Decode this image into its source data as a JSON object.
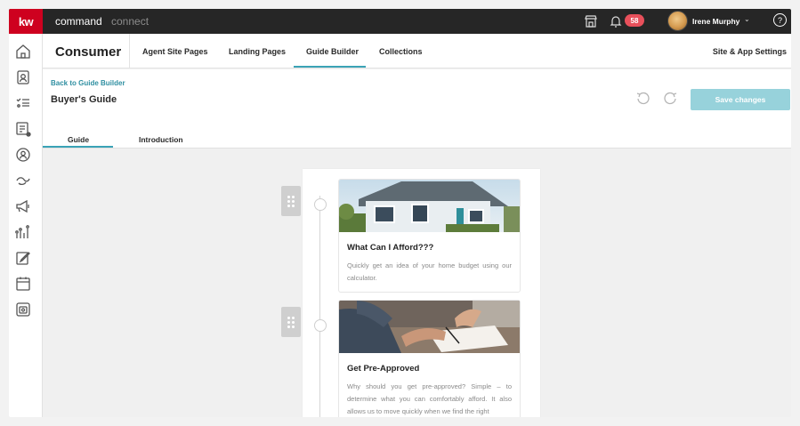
{
  "topbar": {
    "logo": "kw",
    "brand_primary": "command",
    "brand_secondary": "connect",
    "notification_count": "58",
    "user_name": "Irene Murphy",
    "user_caret": "⌄",
    "help_label": "?"
  },
  "sidebar": {
    "items": [
      {
        "icon": "home-icon"
      },
      {
        "icon": "contacts-icon"
      },
      {
        "icon": "tasks-icon"
      },
      {
        "icon": "opportunities-icon"
      },
      {
        "icon": "location-user-icon"
      },
      {
        "icon": "handshake-icon"
      },
      {
        "icon": "megaphone-icon"
      },
      {
        "icon": "analytics-icon"
      },
      {
        "icon": "designs-icon"
      },
      {
        "icon": "calendar-icon"
      },
      {
        "icon": "app-settings-icon"
      }
    ]
  },
  "subnav": {
    "section_title": "Consumer",
    "tabs": [
      {
        "label": "Agent Site Pages"
      },
      {
        "label": "Landing Pages"
      },
      {
        "label": "Guide Builder",
        "active": true
      },
      {
        "label": "Collections"
      }
    ],
    "settings_label": "Site & App Settings"
  },
  "guide_header": {
    "back_link": "Back to Guide Builder",
    "title": "Buyer's Guide",
    "save_label": "Save changes",
    "tabs": [
      {
        "label": "Guide",
        "active": true
      },
      {
        "label": "Introduction"
      }
    ]
  },
  "guide_steps": [
    {
      "title": "What Can I Afford???",
      "description": "Quickly get an idea of your home budget using our calculator.",
      "image": "house-photo"
    },
    {
      "title": "Get Pre-Approved",
      "description": "Why should you get pre-approved? Simple – to determine what you can comfortably afford. It also allows us to move quickly when we find the right",
      "image": "signing-document-photo"
    }
  ],
  "colors": {
    "brand_red": "#ce011f",
    "accent_teal": "#3aa3b6",
    "save_button": "#97d2db",
    "badge": "#e8505b"
  }
}
